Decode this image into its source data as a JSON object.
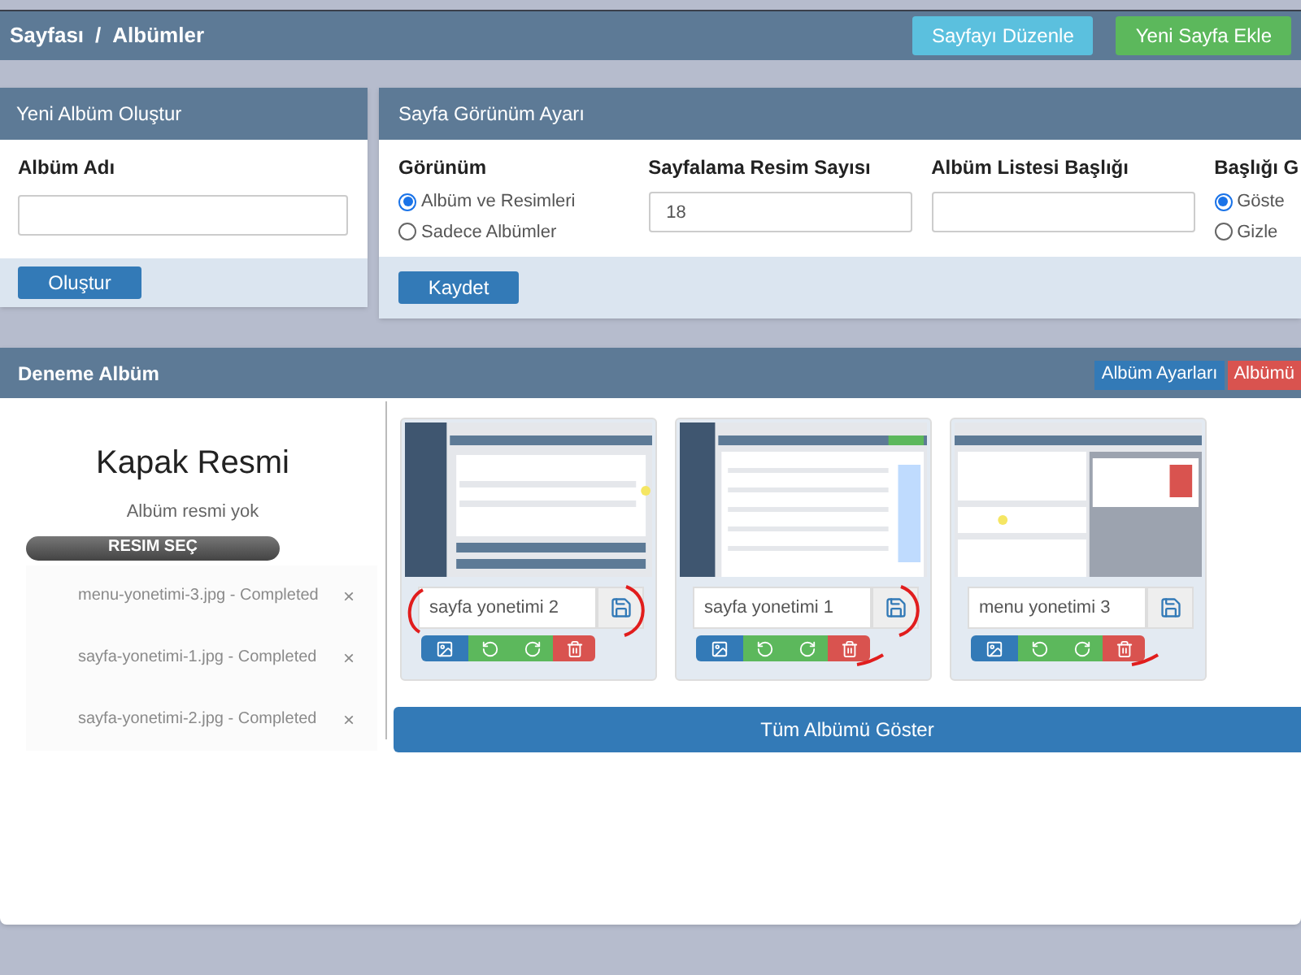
{
  "breadcrumb": {
    "items": [
      "Sayfası",
      "Albümler"
    ],
    "separator": "/"
  },
  "header_buttons": [
    {
      "label": "Sayfayı Düzenle",
      "kind": "info"
    },
    {
      "label": "Yeni Sayfa Ekle",
      "kind": "success"
    }
  ],
  "new_album": {
    "title": "Yeni Albüm Oluştur",
    "field_label": "Albüm Adı",
    "button": "Oluştur"
  },
  "view_settings": {
    "title": "Sayfa Görünüm Ayarı",
    "button": "Kaydet",
    "groups": [
      {
        "kind": "radio",
        "label": "Görünüm",
        "options": [
          {
            "label": "Albüm ve Resimleri",
            "selected": true
          },
          {
            "label": "Sadece Albümler",
            "selected": false
          }
        ]
      },
      {
        "kind": "field",
        "label": "Sayfalama Resim Sayısı",
        "value": "18"
      },
      {
        "kind": "field",
        "label": "Albüm Listesi Başlığı"
      },
      {
        "kind": "radio",
        "label": "Başlığı G",
        "options": [
          {
            "label": "Göste",
            "selected": true
          },
          {
            "label": "Gizle",
            "selected": false
          }
        ]
      }
    ]
  },
  "album": {
    "title": "Deneme Albüm",
    "buttons": [
      {
        "label": "Albüm Ayarları",
        "kind": "primary"
      },
      {
        "label": "Albümü",
        "kind": "danger"
      }
    ],
    "cover": {
      "title": "Kapak Resmi",
      "note": "Albüm resmi yok",
      "button": "RESIM SEÇ"
    },
    "uploads": [
      {
        "name": "menu-yonetimi-3.jpg - Completed",
        "remove": "×"
      },
      {
        "name": "sayfa-yonetimi-1.jpg - Completed",
        "remove": "×"
      },
      {
        "name": "sayfa-yonetimi-2.jpg - Completed",
        "remove": "×"
      }
    ],
    "images": [
      {
        "caption": "sayfa yonetimi 2"
      },
      {
        "caption": "sayfa yonetimi 1"
      },
      {
        "caption": "menu yonetimi 3"
      }
    ],
    "show_all": "Tüm Albümü Göster"
  }
}
